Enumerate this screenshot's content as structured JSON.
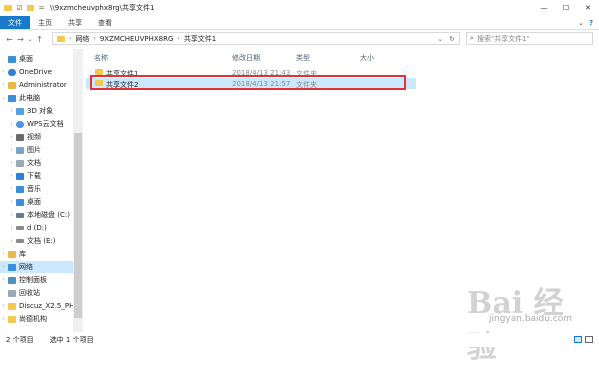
{
  "window": {
    "title": "\\\\9xzmcheuvphx8rg\\共享文件1",
    "controls": {
      "minimize": "—",
      "maximize": "☐",
      "close": "✕"
    }
  },
  "ribbon": {
    "tabs": [
      "文件",
      "主页",
      "共享",
      "查看"
    ],
    "expand": "⌄",
    "help": "?"
  },
  "nav": {
    "back": "←",
    "forward": "→",
    "recent": "⌄",
    "up": "↑"
  },
  "address": {
    "crumbs": [
      "网络",
      "9XZMCHEUVPHX8RG",
      "共享文件1"
    ],
    "dropdown": "⌄",
    "refresh": "↻"
  },
  "search": {
    "placeholder": "搜索\"共享文件1\""
  },
  "sidebar": {
    "items": [
      {
        "label": "桌面",
        "icon": "desktop-icon",
        "color": "#3b8ed8"
      },
      {
        "label": "OneDrive",
        "icon": "onedrive-icon",
        "color": "#2f7fd3"
      },
      {
        "label": "Administrator",
        "icon": "user-icon",
        "color": "#e9b949"
      },
      {
        "label": "此电脑",
        "icon": "computer-icon",
        "color": "#3b8ed8"
      },
      {
        "label": "3D 对象",
        "icon": "3d-objects-icon",
        "color": "#5aa0e0"
      },
      {
        "label": "WPS云文档",
        "icon": "wps-cloud-icon",
        "color": "#4f93e6"
      },
      {
        "label": "视频",
        "icon": "video-icon",
        "color": "#6b6b6b"
      },
      {
        "label": "图片",
        "icon": "picture-icon",
        "color": "#7aa3c8"
      },
      {
        "label": "文档",
        "icon": "document-icon",
        "color": "#9aa9b8"
      },
      {
        "label": "下载",
        "icon": "download-icon",
        "color": "#2f7fd3"
      },
      {
        "label": "音乐",
        "icon": "music-icon",
        "color": "#3b8ed8"
      },
      {
        "label": "桌面",
        "icon": "desktop-icon",
        "color": "#3b8ed8"
      },
      {
        "label": "本地磁盘 (C:)",
        "icon": "drive-icon",
        "color": "#6b7a8a"
      },
      {
        "label": "d (D:)",
        "icon": "drive-icon",
        "color": "#8a8a8a"
      },
      {
        "label": "文档 (E:)",
        "icon": "drive-icon",
        "color": "#8a8a8a"
      },
      {
        "label": "库",
        "icon": "library-icon",
        "color": "#e9b949"
      },
      {
        "label": "网络",
        "icon": "network-icon",
        "color": "#3b8ed8"
      },
      {
        "label": "控制面板",
        "icon": "control-panel-icon",
        "color": "#4a90c0"
      },
      {
        "label": "回收站",
        "icon": "recycle-bin-icon",
        "color": "#9aa9b8"
      },
      {
        "label": "Discuz_X2.5_PH",
        "icon": "folder-icon",
        "color": "#f4c94d"
      },
      {
        "label": "尚德机构",
        "icon": "folder-icon",
        "color": "#f4c94d"
      }
    ]
  },
  "columns": {
    "name": "名称",
    "date": "修改日期",
    "type": "类型",
    "size": "大小"
  },
  "files": [
    {
      "name": "共享文件1",
      "date": "2018/4/13 21:43",
      "type": "文件夹"
    },
    {
      "name": "共享文件2",
      "date": "2018/4/13 21:57",
      "type": "文件夹"
    }
  ],
  "status": {
    "count": "2 个项目",
    "selected": "选中 1 个项目"
  },
  "watermark": {
    "logo": "Bai 经验",
    "url": "jingyan.baidu.com"
  }
}
